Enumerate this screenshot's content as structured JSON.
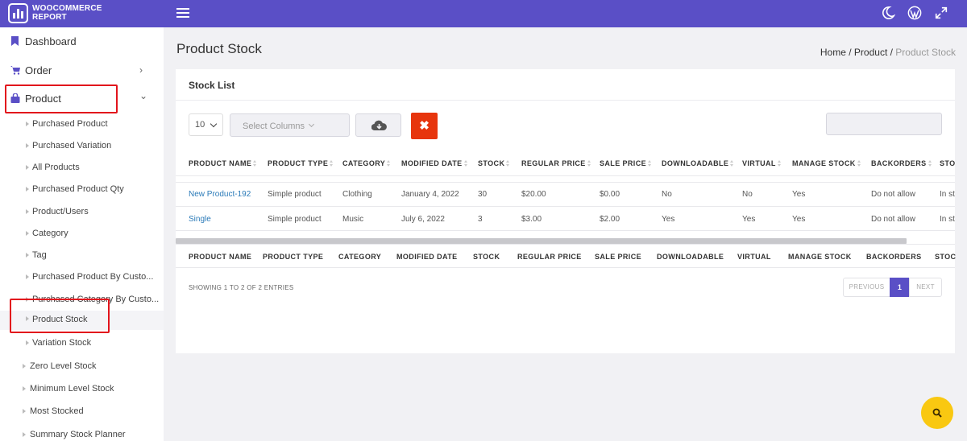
{
  "brand": {
    "line1": "WOOCOMMERCE",
    "line2": "REPORT",
    "color": "#5a4fc6"
  },
  "topbar_icons": [
    "menu-icon",
    "moon-icon",
    "wordpress-icon",
    "expand-icon"
  ],
  "sidebar": {
    "main_items": [
      {
        "label": "Dashboard",
        "icon": "bookmark-icon"
      },
      {
        "label": "Order",
        "icon": "cart-icon",
        "chevron": "›"
      },
      {
        "label": "Product",
        "icon": "bag-icon",
        "chevron": "⌄"
      }
    ],
    "product_sub_items": [
      "Purchased Product",
      "Purchased Variation",
      "All Products",
      "Purchased Product Qty",
      "Product/Users",
      "Category",
      "Tag",
      "Purchased Product By Custo...",
      "Purchased Category By Custo...",
      "Product Stock",
      "Variation Stock"
    ],
    "other_items": [
      "Zero Level Stock",
      "Minimum Level Stock",
      "Most Stocked",
      "Summary Stock Planner"
    ],
    "active_item": "Product Stock"
  },
  "page": {
    "title": "Product Stock",
    "breadcrumb": {
      "home": "Home",
      "sep1": " / ",
      "section": "Product",
      "sep2": " / ",
      "current": "Product Stock"
    }
  },
  "card": {
    "title": "Stock List",
    "page_length": "10",
    "columns_placeholder": "Select Columns",
    "download_icon": "cloud-download-icon",
    "clear_label": "✖",
    "columns": [
      "PRODUCT NAME",
      "PRODUCT TYPE",
      "CATEGORY",
      "MODIFIED DATE",
      "STOCK",
      "REGULAR PRICE",
      "SALE PRICE",
      "DOWNLOADABLE",
      "VIRTUAL",
      "MANAGE STOCK",
      "BACKORDERS",
      "STO"
    ],
    "footer_columns": [
      "PRODUCT NAME",
      "PRODUCT TYPE",
      "CATEGORY",
      "MODIFIED DATE",
      "STOCK",
      "REGULAR PRICE",
      "SALE PRICE",
      "DOWNLOADABLE",
      "VIRTUAL",
      "MANAGE STOCK",
      "BACKORDERS",
      "STOC"
    ],
    "rows": [
      [
        "New Product-192",
        "Simple product",
        "Clothing",
        "January 4, 2022",
        "30",
        "$20.00",
        "$0.00",
        "No",
        "No",
        "Yes",
        "Do not allow",
        "In st"
      ],
      [
        "Single",
        "Simple product",
        "Music",
        "July 6, 2022",
        "3",
        "$3.00",
        "$2.00",
        "Yes",
        "Yes",
        "Yes",
        "Do not allow",
        "In st"
      ]
    ],
    "info": "SHOWING 1 TO 2 OF 2 ENTRIES",
    "pagination": {
      "previous": "PREVIOUS",
      "current": "1",
      "next": "NEXT"
    }
  },
  "fab_icon": "search-icon"
}
